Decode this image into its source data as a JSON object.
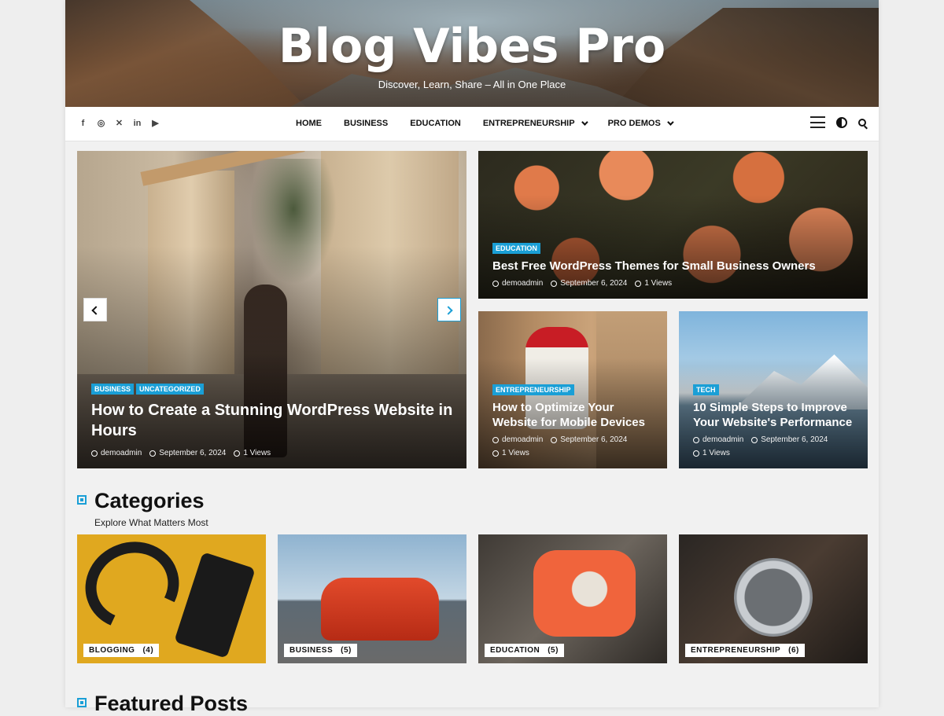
{
  "site": {
    "title": "Blog Vibes Pro",
    "tagline": "Discover, Learn, Share – All in One Place"
  },
  "nav": {
    "social": [
      {
        "icon": "facebook-icon",
        "glyph": "f"
      },
      {
        "icon": "instagram-icon",
        "glyph": "◎"
      },
      {
        "icon": "x-icon",
        "glyph": "✕"
      },
      {
        "icon": "linkedin-icon",
        "glyph": "in"
      },
      {
        "icon": "youtube-icon",
        "glyph": "▶"
      }
    ],
    "menu": [
      "HOME",
      "BUSINESS",
      "EDUCATION",
      "ENTREPRENEURSHIP",
      "PRO DEMOS"
    ]
  },
  "slider": {
    "badges": [
      "BUSINESS",
      "UNCATEGORIZED"
    ],
    "title": "How to Create a Stunning WordPress Website in Hours",
    "author": "demoadmin",
    "date": "September 6, 2024",
    "views": "1 Views"
  },
  "posts": [
    {
      "badge": "EDUCATION",
      "title": "Best Free WordPress Themes for Small Business Owners",
      "author": "demoadmin",
      "date": "September 6, 2024",
      "views": "1 Views"
    },
    {
      "badge": "ENTREPRENEURSHIP",
      "title": "How to Optimize Your Website for Mobile Devices",
      "author": "demoadmin",
      "date": "September 6, 2024",
      "views": "1 Views"
    },
    {
      "badge": "TECH",
      "title": "10 Simple Steps to Improve Your Website's Performance",
      "author": "demoadmin",
      "date": "September 6, 2024",
      "views": "1 Views"
    }
  ],
  "categories": {
    "title": "Categories",
    "subtitle": "Explore What Matters Most",
    "items": [
      {
        "name": "BLOGGING",
        "count": "(4)"
      },
      {
        "name": "BUSINESS",
        "count": "(5)"
      },
      {
        "name": "EDUCATION",
        "count": "(5)"
      },
      {
        "name": "ENTREPRENEURSHIP",
        "count": "(6)"
      }
    ]
  },
  "featured": {
    "title": "Featured Posts"
  },
  "colors": {
    "accent": "#1a9fd6"
  }
}
